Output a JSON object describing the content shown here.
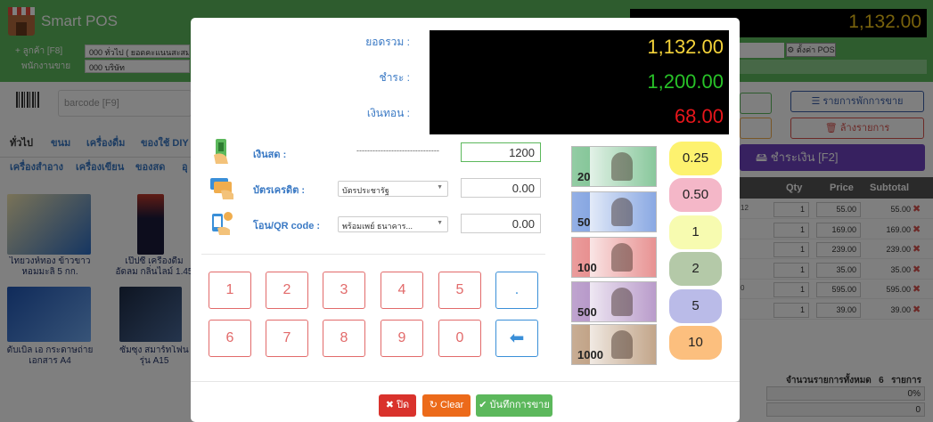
{
  "app": {
    "title": "Smart POS"
  },
  "header": {
    "customer_label": "+ ลูกค้า [F8]",
    "employee_label": "พนักงานขาย",
    "customer_value": "000 ทั่วไป ( ยอดคะแนนสะสมก",
    "employee_value": "000 บริษัท",
    "grand_total": "1,132.00",
    "pos_button": "⚙ ตั้งค่า POS"
  },
  "barcode": {
    "placeholder": "barcode [F9]"
  },
  "categories": [
    "ทั่วไป",
    "ขนม",
    "เครื่องดื่ม",
    "ของใช้ DIY",
    "เครื่องสำอาง",
    "เครื่องเขียน",
    "ของสด",
    "อุ"
  ],
  "products": [
    {
      "name": "ไทยวงห์ทอง ข้าวขาวหอมมะลิ 5 กก."
    },
    {
      "name": "เป๊ปซี่ เครื่องดื่มอัดลม กลิ่นไลม์ 1.45 ล"
    },
    {
      "name": "ดับเบิ้ล เอ กระดาษถ่ายเอกสาร A4"
    },
    {
      "name": "ซัมซุง สมาร์ทโฟน รุ่น A15"
    }
  ],
  "right_panel": {
    "suspended_label": "☰ รายการพักการขาย",
    "clear_items_label": "🗑 ล้างรายการ",
    "pay_label": "🖴 ชำระเงิน [F2]",
    "columns": [
      "Qty",
      "Price",
      "Subtotal"
    ],
    "rows": [
      {
        "qty": "1",
        "price": "55.00",
        "subtotal": "55.00",
        "note": "12"
      },
      {
        "qty": "1",
        "price": "169.00",
        "subtotal": "169.00",
        "note": ""
      },
      {
        "qty": "1",
        "price": "239.00",
        "subtotal": "239.00",
        "note": ""
      },
      {
        "qty": "1",
        "price": "35.00",
        "subtotal": "35.00",
        "note": ""
      },
      {
        "qty": "1",
        "price": "595.00",
        "subtotal": "595.00",
        "note": "0"
      },
      {
        "qty": "1",
        "price": "39.00",
        "subtotal": "39.00",
        "note": ""
      }
    ],
    "total_items_label": "จำนวนรายการทั้งหมด",
    "total_items_value": "6",
    "total_items_unit": "รายการ",
    "discount": "0%",
    "vat": "0"
  },
  "modal": {
    "total_label": "ยอดรวม :",
    "paid_label": "ชำระ :",
    "change_label": "เงินทอน :",
    "total_value": "1,132.00",
    "paid_value": "1,200.00",
    "change_value": "68.00",
    "colors": {
      "total": "#f5d33a",
      "paid": "#28c228",
      "change": "#e8161b"
    },
    "cash": {
      "label": "เงินสด :",
      "dashes": "-------------------------------",
      "amount": "1200"
    },
    "card": {
      "label": "บัตรเครดิต :",
      "select": "บัตรประชารัฐ",
      "amount": "0.00"
    },
    "transfer": {
      "label": "โอน/QR code :",
      "select": "พร้อมเพย์ ธนาคาร...",
      "amount": "0.00"
    },
    "keypad": [
      "1",
      "2",
      "3",
      "4",
      "5",
      ".",
      "6",
      "7",
      "8",
      "9",
      "0",
      "⬅"
    ],
    "banknotes": [
      {
        "value": "20",
        "color": "#3aa35a"
      },
      {
        "value": "50",
        "color": "#3c6fd0"
      },
      {
        "value": "100",
        "color": "#d84a4a"
      },
      {
        "value": "500",
        "color": "#8b5aa8"
      },
      {
        "value": "1000",
        "color": "#9a6a3c"
      }
    ],
    "coins": [
      {
        "label": "0.25",
        "color": "#fdf26f"
      },
      {
        "label": "0.50",
        "color": "#f4b7c8"
      },
      {
        "label": "1",
        "color": "#f7fbb0"
      },
      {
        "label": "2",
        "color": "#b4c9a8"
      },
      {
        "label": "5",
        "color": "#babbe8"
      },
      {
        "label": "10",
        "color": "#fcbf7e"
      }
    ],
    "buttons": {
      "close": "✖ ปิด",
      "clear": "↻ Clear",
      "save": "✔ บันทึกการขาย"
    }
  }
}
